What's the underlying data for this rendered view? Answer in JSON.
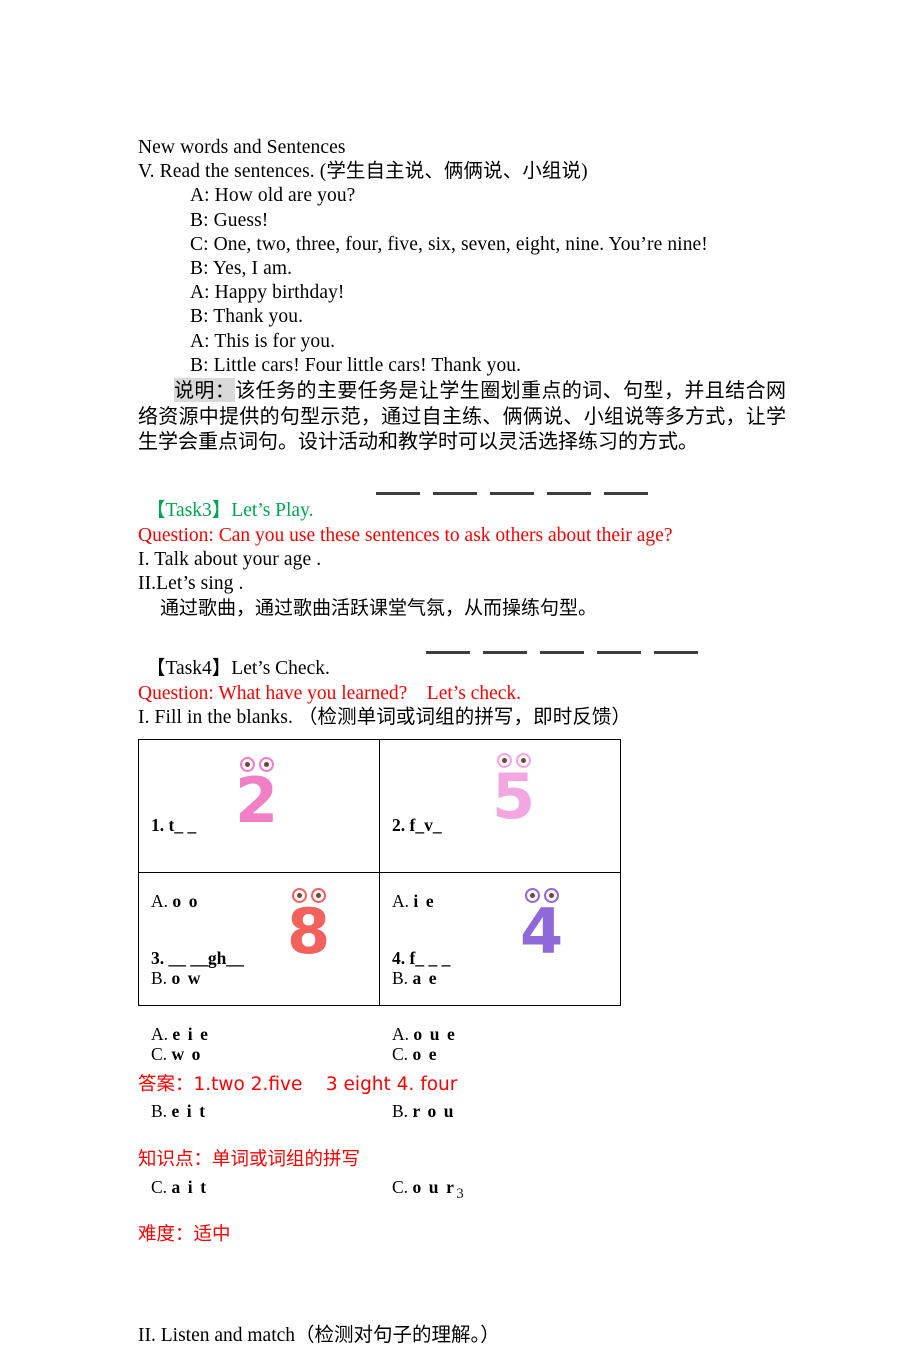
{
  "document": {
    "page_number": "3",
    "heading": "New words and Sentences",
    "section_v": "V. Read the sentences. (学生自主说、俩俩说、小组说)",
    "dialogue": [
      "A: How old are you?",
      "B: Guess!",
      "C: One, two, three, four, five, six, seven, eight, nine. You’re nine!",
      "B: Yes, I am.",
      "A: Happy birthday!",
      "B: Thank you.",
      "A: This is for you.",
      "B: Little cars! Four little cars! Thank you."
    ],
    "note": {
      "label": "说明：",
      "body_line1": "该任务的主要任务是让学生圈划重点的词、句型，并且结合网络资",
      "body_line2": "源中提供的句型示范，通过自主练、俩俩说、小组说等多方式，让学生学会重点",
      "body_line3": "词句。设计活动和教学时可以灵活选择练习的方式。"
    },
    "task3": {
      "label": "【Task3】",
      "title": "Let’s Play.",
      "question": "Question: Can you use these sentences to ask others about their age?",
      "item1": "I. Talk about your age .",
      "item2": "II.Let’s sing .",
      "chinese_note": "通过歌曲，通过歌曲活跃课堂气氛，从而操练句型。"
    },
    "task4": {
      "label": "【Task4】",
      "title": "Let’s Check.",
      "question": "Question: What have you learned?    Let’s check.",
      "item1": "I. Fill in the blanks. （检测单词或词组的拼写，即时反馈）",
      "item2": "II. Listen and match（检测对句子的理解。）"
    },
    "quiz": {
      "cells": [
        {
          "stem": "1. t_ _",
          "options": [
            {
              "letter": "A.",
              "value": "o o"
            },
            {
              "letter": "B.",
              "value": "o w"
            },
            {
              "letter": "C.",
              "value": "w o"
            }
          ],
          "figure": {
            "glyph": "2",
            "name": "number-2-creature",
            "color": "#f07fc6",
            "dot_color": "#8a5ad8"
          }
        },
        {
          "stem": "2. f_v_",
          "options": [
            {
              "letter": "A.",
              "value": "i e"
            },
            {
              "letter": "B.",
              "value": "a e"
            },
            {
              "letter": "C.",
              "value": "o e"
            }
          ],
          "figure": {
            "glyph": "5",
            "name": "number-5-creature",
            "color": "#f2a7e0",
            "dot_color": "#e07ac8"
          }
        },
        {
          "stem": "3. __ __gh__",
          "options": [
            {
              "letter": "A.",
              "value": "e i e"
            },
            {
              "letter": "B.",
              "value": "e i t"
            },
            {
              "letter": "C.",
              "value": "a i t"
            }
          ],
          "figure": {
            "glyph": "8",
            "name": "number-8-creature",
            "color": "#f2615c",
            "dot_color": "#f07fc6"
          }
        },
        {
          "stem": "4. f_ _ _",
          "options": [
            {
              "letter": "A.",
              "value": "o u e"
            },
            {
              "letter": "B.",
              "value": "r o u"
            },
            {
              "letter": "C.",
              "value": "o u r"
            }
          ],
          "figure": {
            "glyph": "4",
            "name": "number-4-creature",
            "color": "#8f69d9",
            "dot_color": "#6d4ab5"
          }
        }
      ]
    },
    "answer_block": {
      "answers": "答案：1.two 2.five    3 eight 4. four",
      "knowledge": "知识点：单词或词组的拼写",
      "difficulty": "难度：适中"
    },
    "colors": {
      "green": "#00a650",
      "red": "#ff0000",
      "highlight": "#d9d9d9",
      "rule": "#3d3d3d"
    }
  }
}
